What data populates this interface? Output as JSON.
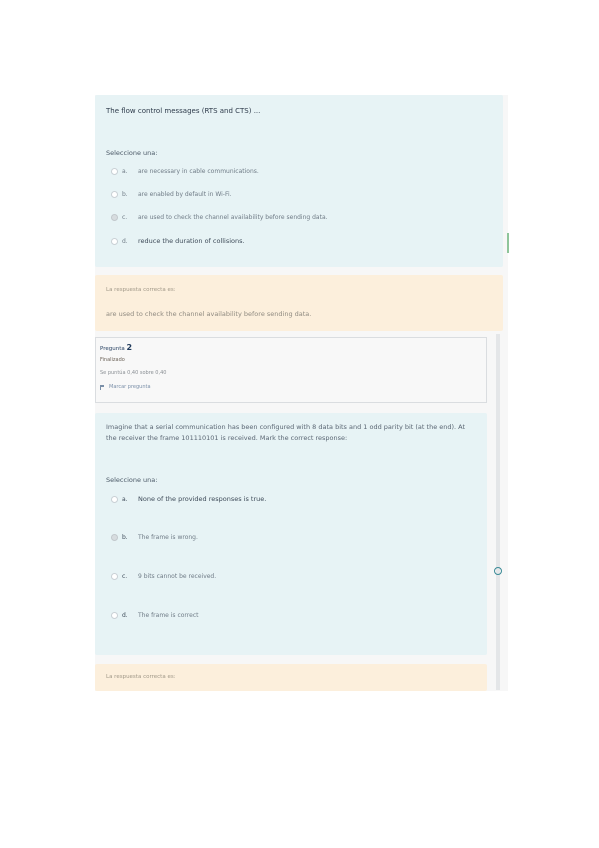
{
  "question1": {
    "text": "The flow control messages (RTS and CTS) ...",
    "select_label": "Seleccione una:",
    "options": [
      {
        "letter": "a.",
        "text": "are necessary in cable communications.",
        "selected": false
      },
      {
        "letter": "b.",
        "text": "are enabled by default in Wi-Fi.",
        "selected": false
      },
      {
        "letter": "c.",
        "text": "are used to check the channel availability before sending data.",
        "selected": true
      },
      {
        "letter": "d.",
        "text": "reduce the duration of collisions.",
        "selected": false
      }
    ],
    "feedback_label": "La respuesta correcta es:",
    "feedback_answer": "are used to check the channel availability before sending data."
  },
  "question2_info": {
    "label": "Pregunta",
    "number": "2",
    "state": "Finalizado",
    "score": "Se puntúa 0,40 sobre 0,40",
    "flag_label": "Marcar pregunta"
  },
  "question2": {
    "text": "Imagine that a serial communication has been configured with 8 data bits and 1 odd parity bit (at the end). At the receiver the frame 101110101 is received. Mark the correct response:",
    "select_label": "Seleccione una:",
    "options": [
      {
        "letter": "a.",
        "text": "None of the provided responses is true.",
        "selected": false
      },
      {
        "letter": "b.",
        "text": "The frame is wrong.",
        "selected": true
      },
      {
        "letter": "c.",
        "text": "9 bits cannot be received.",
        "selected": false
      },
      {
        "letter": "d.",
        "text": "The frame is correct",
        "selected": false
      }
    ],
    "feedback_label": "La respuesta correcta es:"
  },
  "colors": {
    "card_bg": "#e7f3f5",
    "feedback_bg": "#fcefdc",
    "accent": "#3a8a96"
  }
}
